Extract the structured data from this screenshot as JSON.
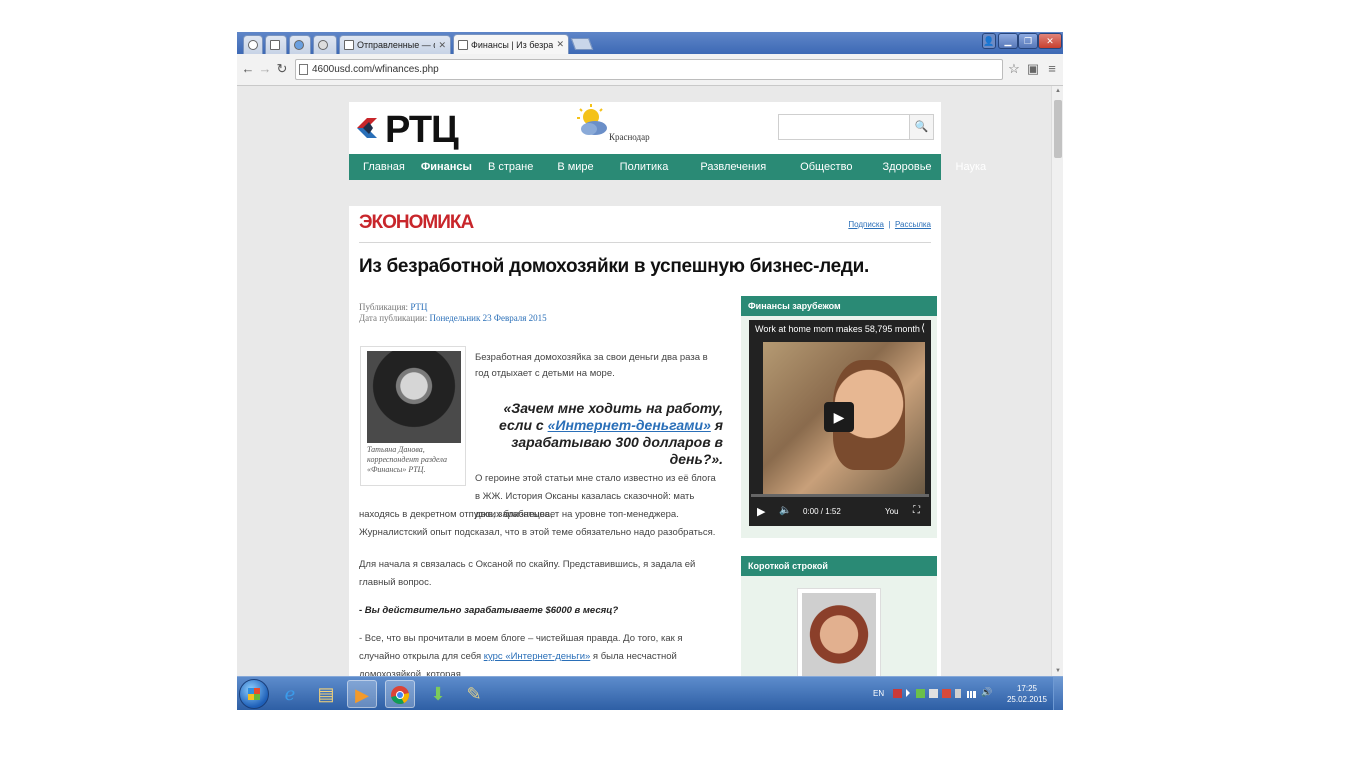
{
  "browser": {
    "tabs": [
      {
        "label": "",
        "icon": "chrome-app-icon"
      },
      {
        "label": "",
        "icon": "image-icon"
      },
      {
        "label": "",
        "icon": "ie-icon"
      },
      {
        "label": "",
        "icon": "puzzle-icon"
      },
      {
        "label": "Отправленные — dwitel",
        "icon": "mail-icon"
      },
      {
        "label": "Финансы | Из безработн",
        "icon": "page-icon",
        "active": true
      }
    ],
    "url": "4600usd.com/wfinances.php"
  },
  "site": {
    "logo_text": "РТЦ",
    "weather_city": "Краснодар",
    "search_placeholder": "",
    "search_icon": "search-icon",
    "nav": [
      "Главная",
      "Финансы",
      "В стране",
      "В мире",
      "Политика",
      "Развлечения",
      "Общество",
      "Здоровье",
      "Наука"
    ],
    "nav_active": "Финансы",
    "accent_color": "#2a8a75",
    "section_color": "#c8262b"
  },
  "article": {
    "section": "ЭКОНОМИКА",
    "link_subscribe": "Подписка",
    "link_mailing": "Рассылка",
    "headline": "Из безработной домохозяйки в успешную бизнес-леди.",
    "meta_published_label": "Публикация:",
    "meta_published_value": "РТЦ",
    "meta_date_label": "Дата публикации:",
    "meta_date_value": "Понедельник 23 Февраля 2015",
    "photo_caption": "Татьяна Данова, корреспондент раздела «Финансы» РТЦ.",
    "lead": "Безработная домохозяйка за свои деньги два раза в год отдыхает с детьми на море.",
    "quote_part1": "«Зачем мне ходить на работу, если с ",
    "quote_link": "«Интернет-деньгами»",
    "quote_part2": " я зарабатываю 300 долларов в день?».",
    "p1a": "О героине этой статьи мне стало известно из её блога в ЖЖ. История Оксаны казалась сказочной: мать двоих близнецов,",
    "p1b": "находясь в декретном отпуске, зарабатывает на уровне топ-менеджера. Журналистский опыт подсказал, что в этой теме обязательно надо разобраться.",
    "p2": "Для начала я связалась с Оксаной по скайпу. Представившись, я задала ей главный вопрос.",
    "p3": "- Вы действительно зарабатываете $6000 в месяц?",
    "p4_part1": "- Все, что вы прочитали в моем блоге – чистейшая правда. До того, как я случайно открыла для себя ",
    "p4_link": "курс «Интернет-деньги»",
    "p4_part2": " я была несчастной домохозяйкой, которая"
  },
  "sidebar": {
    "widget1_title": "Финансы зарубежом",
    "video_title": "Work at home mom makes 58,795 month",
    "video_time": "0:00 / 1:52",
    "video_progress": 0.0,
    "widget2_title": "Короткой строкой"
  },
  "taskbar": {
    "apps": [
      "start-icon",
      "ie-icon",
      "explorer-icon",
      "media-icon",
      "chrome-icon",
      "download-icon",
      "paint-icon"
    ],
    "lang": "EN",
    "time": "17:25",
    "date": "25.02.2015"
  }
}
